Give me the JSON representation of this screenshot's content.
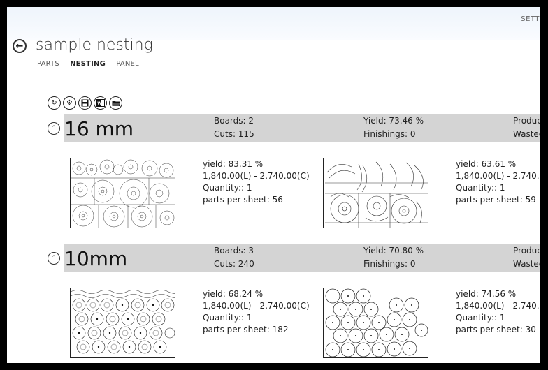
{
  "header": {
    "settings_label": "SETT"
  },
  "page": {
    "title": "sample nesting"
  },
  "tabs": [
    {
      "label": "PARTS",
      "active": false
    },
    {
      "label": "NESTING",
      "active": true
    },
    {
      "label": "PANEL",
      "active": false
    }
  ],
  "toolbar": [
    {
      "name": "refresh-icon"
    },
    {
      "name": "gear-icon"
    },
    {
      "name": "save-icon"
    },
    {
      "name": "word-export-icon"
    },
    {
      "name": "open-folder-icon"
    }
  ],
  "groups": [
    {
      "name": "16 mm",
      "boards": "Boards: 2",
      "cuts": "Cuts: 115",
      "yield": "Yield: 73.46 %",
      "finishings": "Finishings: 0",
      "production": "Produc",
      "wasted": "Wastec",
      "sheets": [
        {
          "yield": "yield: 83.31 %",
          "size": "1,840.00(L) - 2,740.00(C)",
          "quantity": "Quantity:: 1",
          "parts": "parts per sheet: 56"
        },
        {
          "yield": "yield: 63.61 %",
          "size": "1,840.00(L) - 2,740.00",
          "quantity": "Quantity:: 1",
          "parts": "parts per sheet: 59"
        }
      ]
    },
    {
      "name": "10mm",
      "boards": "Boards: 3",
      "cuts": "Cuts: 240",
      "yield": "Yield: 70.80 %",
      "finishings": "Finishings: 0",
      "production": "Produc",
      "wasted": "Wastec",
      "sheets": [
        {
          "yield": "yield: 68.24 %",
          "size": "1,840.00(L) - 2,740.00(C)",
          "quantity": "Quantity:: 1",
          "parts": "parts per sheet: 182"
        },
        {
          "yield": "yield: 74.56 %",
          "size": "1,840.00(L) - 2,740.00",
          "quantity": "Quantity:: 1",
          "parts": "parts per sheet: 30"
        }
      ]
    }
  ]
}
